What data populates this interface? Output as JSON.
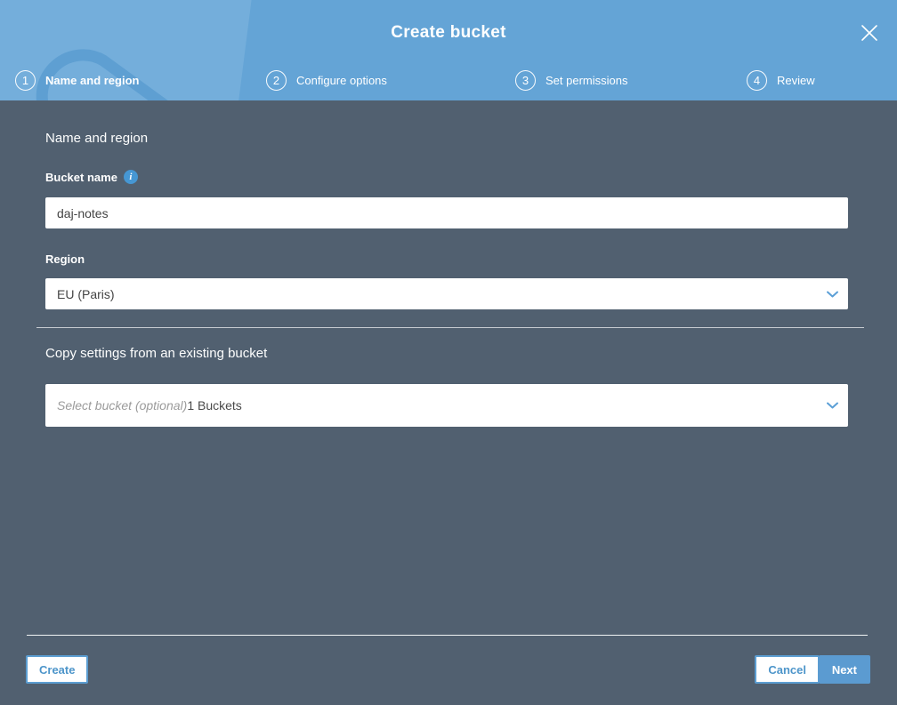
{
  "header": {
    "title": "Create bucket",
    "steps": [
      {
        "number": "1",
        "label": "Name and region",
        "active": true
      },
      {
        "number": "2",
        "label": "Configure options",
        "active": false
      },
      {
        "number": "3",
        "label": "Set permissions",
        "active": false
      },
      {
        "number": "4",
        "label": "Review",
        "active": false
      }
    ]
  },
  "form": {
    "section_title": "Name and region",
    "bucket_name": {
      "label": "Bucket name",
      "value": "daj-notes"
    },
    "region": {
      "label": "Region",
      "selected": "EU (Paris)"
    },
    "copy_settings": {
      "section_title": "Copy settings from an existing bucket",
      "placeholder": "Select bucket (optional)",
      "buckets_count": "1 Buckets"
    }
  },
  "footer": {
    "create_label": "Create",
    "cancel_label": "Cancel",
    "next_label": "Next"
  },
  "icons": {
    "info": "i",
    "close": "✕",
    "chevron_down": "⌄"
  },
  "colors": {
    "header_blue": "#64a4d6",
    "body_slate": "#516070",
    "accent_blue": "#4d95ca",
    "button_blue": "#5b9bd1",
    "watermark_fill": "#74aedb",
    "watermark_outline": "#5e9fd2"
  }
}
